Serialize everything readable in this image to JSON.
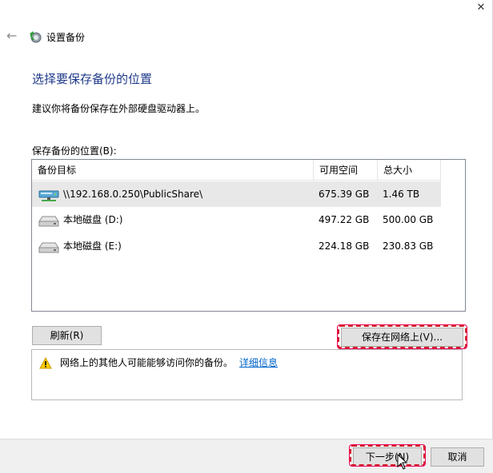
{
  "window": {
    "app_title": "设置备份",
    "close_glyph": "✕",
    "back_glyph": "←"
  },
  "page": {
    "heading": "选择要保存备份的位置",
    "subtitle": "建议你将备份保存在外部硬盘驱动器上。",
    "list_label": "保存备份的位置(B):"
  },
  "table": {
    "columns": [
      "备份目标",
      "可用空间",
      "总大小"
    ],
    "rows": [
      {
        "name": "\\\\192.168.0.250\\PublicShare\\",
        "free": "675.39 GB",
        "total": "1.46 TB",
        "icon": "network-drive-icon"
      },
      {
        "name": "本地磁盘 (D:)",
        "free": "497.22 GB",
        "total": "500.00 GB",
        "icon": "hard-drive-icon"
      },
      {
        "name": "本地磁盘 (E:)",
        "free": "224.18 GB",
        "total": "230.83 GB",
        "icon": "hard-drive-icon"
      }
    ]
  },
  "buttons": {
    "refresh": "刷新(R)",
    "save_network": "保存在网络上(V)...",
    "next": "下一步(N)",
    "cancel": "取消"
  },
  "warning": {
    "text": "网络上的其他人可能能够访问你的备份。",
    "link": "详细信息"
  },
  "colors": {
    "heading": "#1f3a8a",
    "highlight": "#d11b2a",
    "link": "#0066cc"
  }
}
